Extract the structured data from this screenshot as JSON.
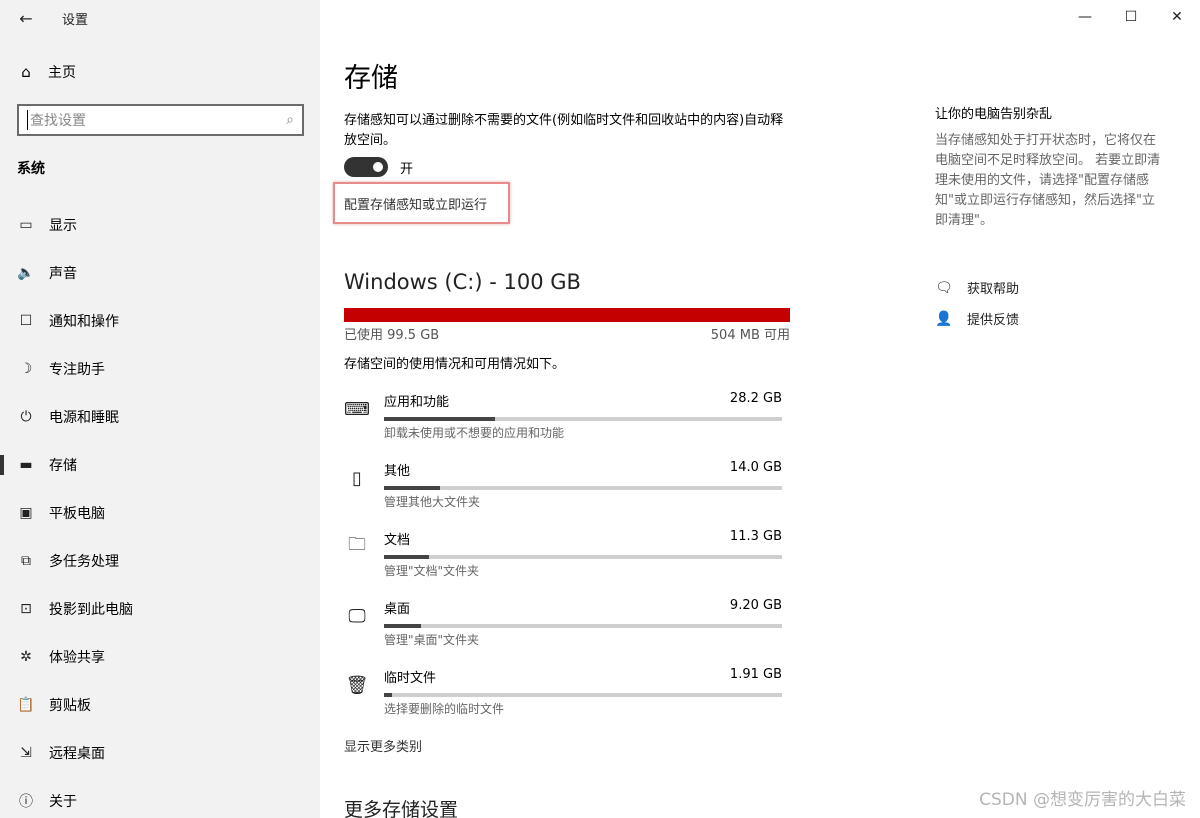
{
  "window": {
    "app_title": "设置",
    "controls": {
      "minimize": "—",
      "maximize": "☐",
      "close": "✕"
    }
  },
  "sidebar": {
    "back_icon": "←",
    "home": {
      "icon": "home-icon",
      "label": "主页"
    },
    "search": {
      "placeholder": "查找设置",
      "icon": "search-icon"
    },
    "section": "系统",
    "items": [
      {
        "label": "显示",
        "icon": "display-icon",
        "glyph": "▭"
      },
      {
        "label": "声音",
        "icon": "sound-icon",
        "glyph": "🔈"
      },
      {
        "label": "通知和操作",
        "icon": "notification-icon",
        "glyph": "☐"
      },
      {
        "label": "专注助手",
        "icon": "moon-icon",
        "glyph": "☽"
      },
      {
        "label": "电源和睡眠",
        "icon": "power-icon",
        "glyph": "⏻"
      },
      {
        "label": "存储",
        "icon": "storage-icon",
        "glyph": "▬",
        "active": true
      },
      {
        "label": "平板电脑",
        "icon": "tablet-icon",
        "glyph": "▣"
      },
      {
        "label": "多任务处理",
        "icon": "multitask-icon",
        "glyph": "⧉"
      },
      {
        "label": "投影到此电脑",
        "icon": "project-icon",
        "glyph": "⊡"
      },
      {
        "label": "体验共享",
        "icon": "share-icon",
        "glyph": "✲"
      },
      {
        "label": "剪贴板",
        "icon": "clipboard-icon",
        "glyph": "📋"
      },
      {
        "label": "远程桌面",
        "icon": "remote-desktop-icon",
        "glyph": "⇲"
      },
      {
        "label": "关于",
        "icon": "info-icon",
        "glyph": "ⓘ"
      }
    ]
  },
  "main": {
    "title": "存储",
    "storage_sense_desc": "存储感知可以通过删除不需要的文件(例如临时文件和回收站中的内容)自动释放空间。",
    "toggle_label": "开",
    "toggle_state": "on",
    "config_link": "配置存储感知或立即运行",
    "drive_title": "Windows (C:) - 100 GB",
    "drive_used": "已使用 99.5 GB",
    "drive_free": "504 MB 可用",
    "drive_used_fraction": 0.995,
    "usage_desc": "存储空间的使用情况和可用情况如下。",
    "categories": [
      {
        "name": "应用和功能",
        "size": "28.2 GB",
        "sub": "卸载未使用或不想要的应用和功能",
        "icon": "keyboard-icon",
        "glyph": "⌨",
        "fraction": 0.28
      },
      {
        "name": "其他",
        "size": "14.0 GB",
        "sub": "管理其他大文件夹",
        "icon": "other-files-icon",
        "glyph": "▯",
        "fraction": 0.14
      },
      {
        "name": "文档",
        "size": "11.3 GB",
        "sub": "管理\"文档\"文件夹",
        "icon": "documents-folder-icon",
        "glyph": "🗀",
        "fraction": 0.113
      },
      {
        "name": "桌面",
        "size": "9.20 GB",
        "sub": "管理\"桌面\"文件夹",
        "icon": "desktop-monitor-icon",
        "glyph": "🖵",
        "fraction": 0.092
      },
      {
        "name": "临时文件",
        "size": "1.91 GB",
        "sub": "选择要删除的临时文件",
        "icon": "trash-icon",
        "glyph": "🗑",
        "fraction": 0.019
      }
    ],
    "show_more": "显示更多类别",
    "more_settings_title": "更多存储设置"
  },
  "right_panel": {
    "title": "让你的电脑告别杂乱",
    "desc": "当存储感知处于打开状态时，它将仅在电脑空间不足时释放空间。 若要立即清理未使用的文件，请选择\"配置存储感知\"或立即运行存储感知，然后选择\"立即清理\"。",
    "links": [
      {
        "label": "获取帮助",
        "icon": "help-chat-icon",
        "glyph": "🗨"
      },
      {
        "label": "提供反馈",
        "icon": "feedback-icon",
        "glyph": "👤"
      }
    ]
  },
  "watermark": "CSDN @想变厉害的大白菜"
}
